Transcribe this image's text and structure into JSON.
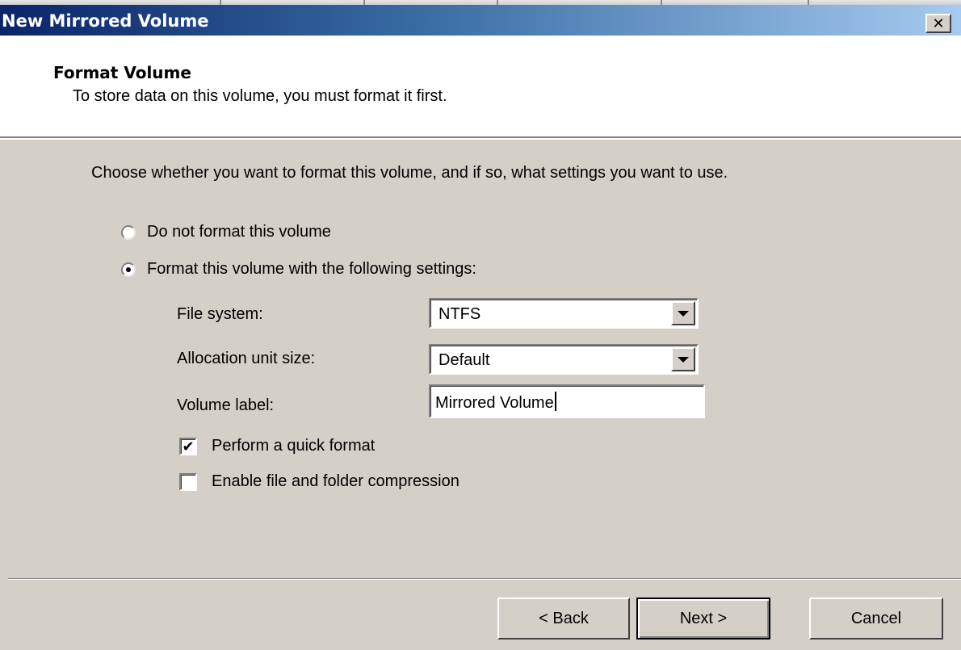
{
  "window": {
    "title": "New Mirrored Volume",
    "close_label": "✕"
  },
  "header": {
    "title": "Format Volume",
    "subtitle": "To store data on this volume, you must format it first."
  },
  "instruction": "Choose whether you want to format this volume, and if so, what settings you want to use.",
  "options": {
    "no_format_label": "Do not format this volume",
    "no_format_selected": false,
    "format_label": "Format this volume with the following settings:",
    "format_selected": true
  },
  "settings": {
    "file_system_label": "File system:",
    "file_system_value": "NTFS",
    "allocation_label": "Allocation unit size:",
    "allocation_value": "Default",
    "volume_label_label": "Volume label:",
    "volume_label_value": "Mirrored Volume"
  },
  "checkboxes": {
    "quick_format_label": "Perform a quick format",
    "quick_format_checked": true,
    "compression_label": "Enable file and folder compression",
    "compression_checked": false
  },
  "buttons": {
    "back": "< Back",
    "next": "Next >",
    "cancel": "Cancel"
  }
}
